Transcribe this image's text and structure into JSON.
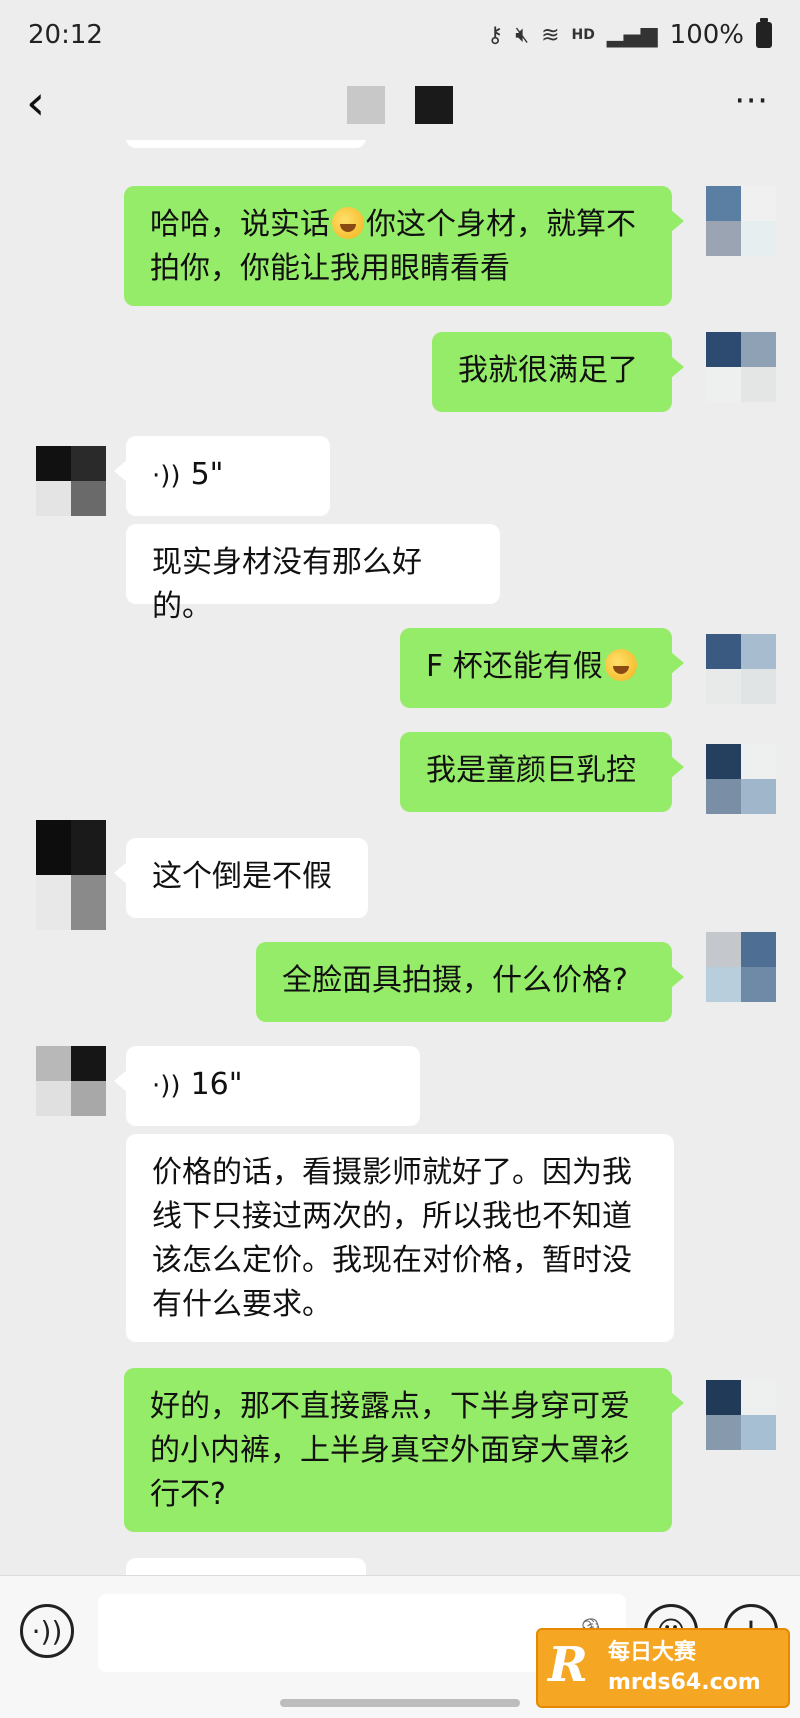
{
  "status_bar": {
    "time": "20:12",
    "hd": "HD",
    "battery": "100%",
    "icons": [
      "key-icon",
      "mute-icon",
      "wifi-icon",
      "signal-icon",
      "battery-icon"
    ]
  },
  "header": {
    "back_icon": "back-icon",
    "more_icon": "more-icon"
  },
  "messages": [
    {
      "side": "right",
      "text_a": "哈哈，说实话",
      "text_b": "你这个身材，就算不拍你，你能让我用眼睛看看"
    },
    {
      "side": "right",
      "text": "我就很满足了"
    },
    {
      "side": "left",
      "type": "voice",
      "duration": "5\""
    },
    {
      "side": "left",
      "text": "现实身材没有那么好的。"
    },
    {
      "side": "right",
      "text": "F 杯还能有假"
    },
    {
      "side": "right",
      "text": "我是童颜巨乳控"
    },
    {
      "side": "left",
      "text": "这个倒是不假"
    },
    {
      "side": "right",
      "text": "全脸面具拍摄，什么价格?"
    },
    {
      "side": "left",
      "type": "voice",
      "duration": "16\""
    },
    {
      "side": "left",
      "text": "价格的话，看摄影师就好了。因为我线下只接过两次的，所以我也不知道该怎么定价。我现在对价格，暂时没有什么要求。"
    },
    {
      "side": "right",
      "text": "好的，那不直接露点，下半身穿可爱的小内裤，上半身真空外面穿大罩衫行不?"
    }
  ],
  "input_bar": {
    "voice_icon": "voice-toggle-icon",
    "mic_icon": "microphone-icon",
    "emoji_icon": "emoji-icon",
    "plus_icon": "plus-icon"
  },
  "watermark": {
    "logo": "R",
    "line1": "每日大赛",
    "line2": "mrds64.com"
  },
  "colors": {
    "background": "#ededed",
    "sent_bubble": "#95ec69",
    "received_bubble": "#ffffff"
  }
}
